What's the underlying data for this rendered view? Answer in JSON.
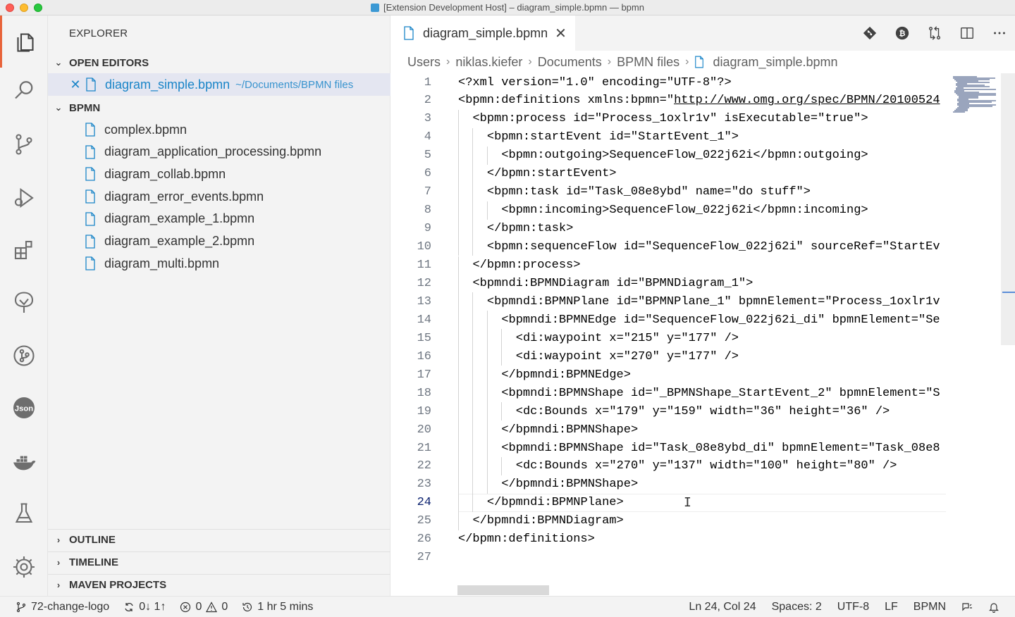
{
  "window": {
    "title": "[Extension Development Host] – diagram_simple.bpmn — bpmn"
  },
  "activity_bar": {
    "items": [
      "explorer-icon",
      "search-icon",
      "source-control-icon",
      "run-debug-icon",
      "extensions-icon",
      "tree-icon",
      "git-graph-icon",
      "json-icon",
      "docker-icon",
      "testing-icon",
      "settings-gear-icon"
    ],
    "json_label": "Json",
    "accent": "#e8633a"
  },
  "sidebar": {
    "title": "EXPLORER",
    "open_editors": {
      "header": "OPEN EDITORS",
      "items": [
        {
          "close": "✕",
          "name": "diagram_simple.bpmn",
          "path": "~/Documents/BPMN files"
        }
      ]
    },
    "folder": {
      "header": "BPMN",
      "files": [
        "complex.bpmn",
        "diagram_application_processing.bpmn",
        "diagram_collab.bpmn",
        "diagram_error_events.bpmn",
        "diagram_example_1.bpmn",
        "diagram_example_2.bpmn",
        "diagram_multi.bpmn"
      ]
    },
    "bottom_sections": [
      "OUTLINE",
      "TIMELINE",
      "MAVEN PROJECTS"
    ]
  },
  "editor": {
    "tab": {
      "label": "diagram_simple.bpmn",
      "close": "✕"
    },
    "tab_actions": [
      "git-icon",
      "bitcoin-icon",
      "compare-icon",
      "split-editor-icon",
      "more-icon"
    ],
    "breadcrumb": [
      "Users",
      "niklas.kiefer",
      "Documents",
      "BPMN files",
      "diagram_simple.bpmn"
    ],
    "current_line": 24,
    "lines": [
      {
        "n": "1",
        "indent": 0,
        "text": "<?xml version=\"1.0\" encoding=\"UTF-8\"?>"
      },
      {
        "n": "2",
        "indent": 0,
        "text": "<bpmn:definitions xmlns:bpmn=\"",
        "url": "http://www.omg.org/spec/BPMN/20100524"
      },
      {
        "n": "3",
        "indent": 1,
        "text": "<bpmn:process id=\"Process_1oxlr1v\" isExecutable=\"true\">"
      },
      {
        "n": "4",
        "indent": 2,
        "text": "<bpmn:startEvent id=\"StartEvent_1\">"
      },
      {
        "n": "5",
        "indent": 3,
        "text": "<bpmn:outgoing>SequenceFlow_022j62i</bpmn:outgoing>"
      },
      {
        "n": "6",
        "indent": 2,
        "text": "</bpmn:startEvent>"
      },
      {
        "n": "7",
        "indent": 2,
        "text": "<bpmn:task id=\"Task_08e8ybd\" name=\"do stuff\">"
      },
      {
        "n": "8",
        "indent": 3,
        "text": "<bpmn:incoming>SequenceFlow_022j62i</bpmn:incoming>"
      },
      {
        "n": "9",
        "indent": 2,
        "text": "</bpmn:task>"
      },
      {
        "n": "10",
        "indent": 2,
        "text": "<bpmn:sequenceFlow id=\"SequenceFlow_022j62i\" sourceRef=\"StartEv"
      },
      {
        "n": "11",
        "indent": 1,
        "text": "</bpmn:process>"
      },
      {
        "n": "12",
        "indent": 1,
        "text": "<bpmndi:BPMNDiagram id=\"BPMNDiagram_1\">"
      },
      {
        "n": "13",
        "indent": 2,
        "text": "<bpmndi:BPMNPlane id=\"BPMNPlane_1\" bpmnElement=\"Process_1oxlr1v"
      },
      {
        "n": "14",
        "indent": 3,
        "text": "<bpmndi:BPMNEdge id=\"SequenceFlow_022j62i_di\" bpmnElement=\"Se"
      },
      {
        "n": "15",
        "indent": 4,
        "text": "<di:waypoint x=\"215\" y=\"177\" />"
      },
      {
        "n": "16",
        "indent": 4,
        "text": "<di:waypoint x=\"270\" y=\"177\" />"
      },
      {
        "n": "17",
        "indent": 3,
        "text": "</bpmndi:BPMNEdge>"
      },
      {
        "n": "18",
        "indent": 3,
        "text": "<bpmndi:BPMNShape id=\"_BPMNShape_StartEvent_2\" bpmnElement=\"S"
      },
      {
        "n": "19",
        "indent": 4,
        "text": "<dc:Bounds x=\"179\" y=\"159\" width=\"36\" height=\"36\" />"
      },
      {
        "n": "20",
        "indent": 3,
        "text": "</bpmndi:BPMNShape>"
      },
      {
        "n": "21",
        "indent": 3,
        "text": "<bpmndi:BPMNShape id=\"Task_08e8ybd_di\" bpmnElement=\"Task_08e8"
      },
      {
        "n": "22",
        "indent": 4,
        "text": "<dc:Bounds x=\"270\" y=\"137\" width=\"100\" height=\"80\" />"
      },
      {
        "n": "23",
        "indent": 3,
        "text": "</bpmndi:BPMNShape>"
      },
      {
        "n": "24",
        "indent": 2,
        "text": "</bpmndi:BPMNPlane>"
      },
      {
        "n": "25",
        "indent": 1,
        "text": "</bpmndi:BPMNDiagram>"
      },
      {
        "n": "26",
        "indent": 0,
        "text": "</bpmn:definitions>"
      },
      {
        "n": "27",
        "indent": 0,
        "text": ""
      }
    ]
  },
  "statusbar": {
    "branch": "72-change-logo",
    "sync": "0↓ 1↑",
    "errors": "0",
    "warnings": "0",
    "time": "1 hr 5 mins",
    "position": "Ln 24, Col 24",
    "spaces": "Spaces: 2",
    "encoding": "UTF-8",
    "eol": "LF",
    "language": "BPMN"
  },
  "colors": {
    "accent_blue": "#1a85c8",
    "selection_bg": "#e4e6f1"
  }
}
